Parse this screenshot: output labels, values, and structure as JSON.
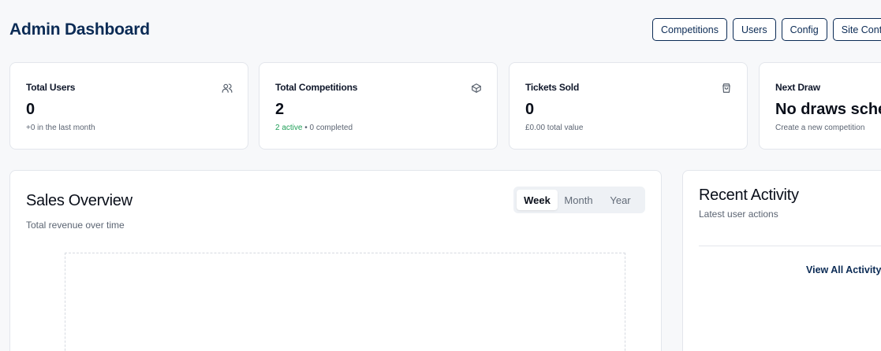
{
  "header": {
    "title": "Admin Dashboard",
    "nav": [
      "Competitions",
      "Users",
      "Config",
      "Site Content"
    ]
  },
  "stats": [
    {
      "label": "Total Users",
      "value": "0",
      "sub": "+0 in the last month",
      "icon": "users-icon"
    },
    {
      "label": "Total Competitions",
      "value": "2",
      "sub_active": "2 active",
      "sub_sep": " • ",
      "sub_rest": "0 completed",
      "icon": "box-icon"
    },
    {
      "label": "Tickets Sold",
      "value": "0",
      "sub": "£0.00 total value",
      "icon": "shopping-bag-icon"
    },
    {
      "label": "Next Draw",
      "value": "No draws scheduled",
      "sub": "Create a new competition"
    }
  ],
  "sales": {
    "title": "Sales Overview",
    "subtitle": "Total revenue over time",
    "periods": [
      "Week",
      "Month",
      "Year"
    ],
    "selected_period": "Week"
  },
  "activity": {
    "title": "Recent Activity",
    "subtitle": "Latest user actions",
    "link": "View All Activity"
  },
  "colors": {
    "brand": "#0b2b55",
    "active_green": "#22a05a",
    "background": "#f7f8fa"
  }
}
